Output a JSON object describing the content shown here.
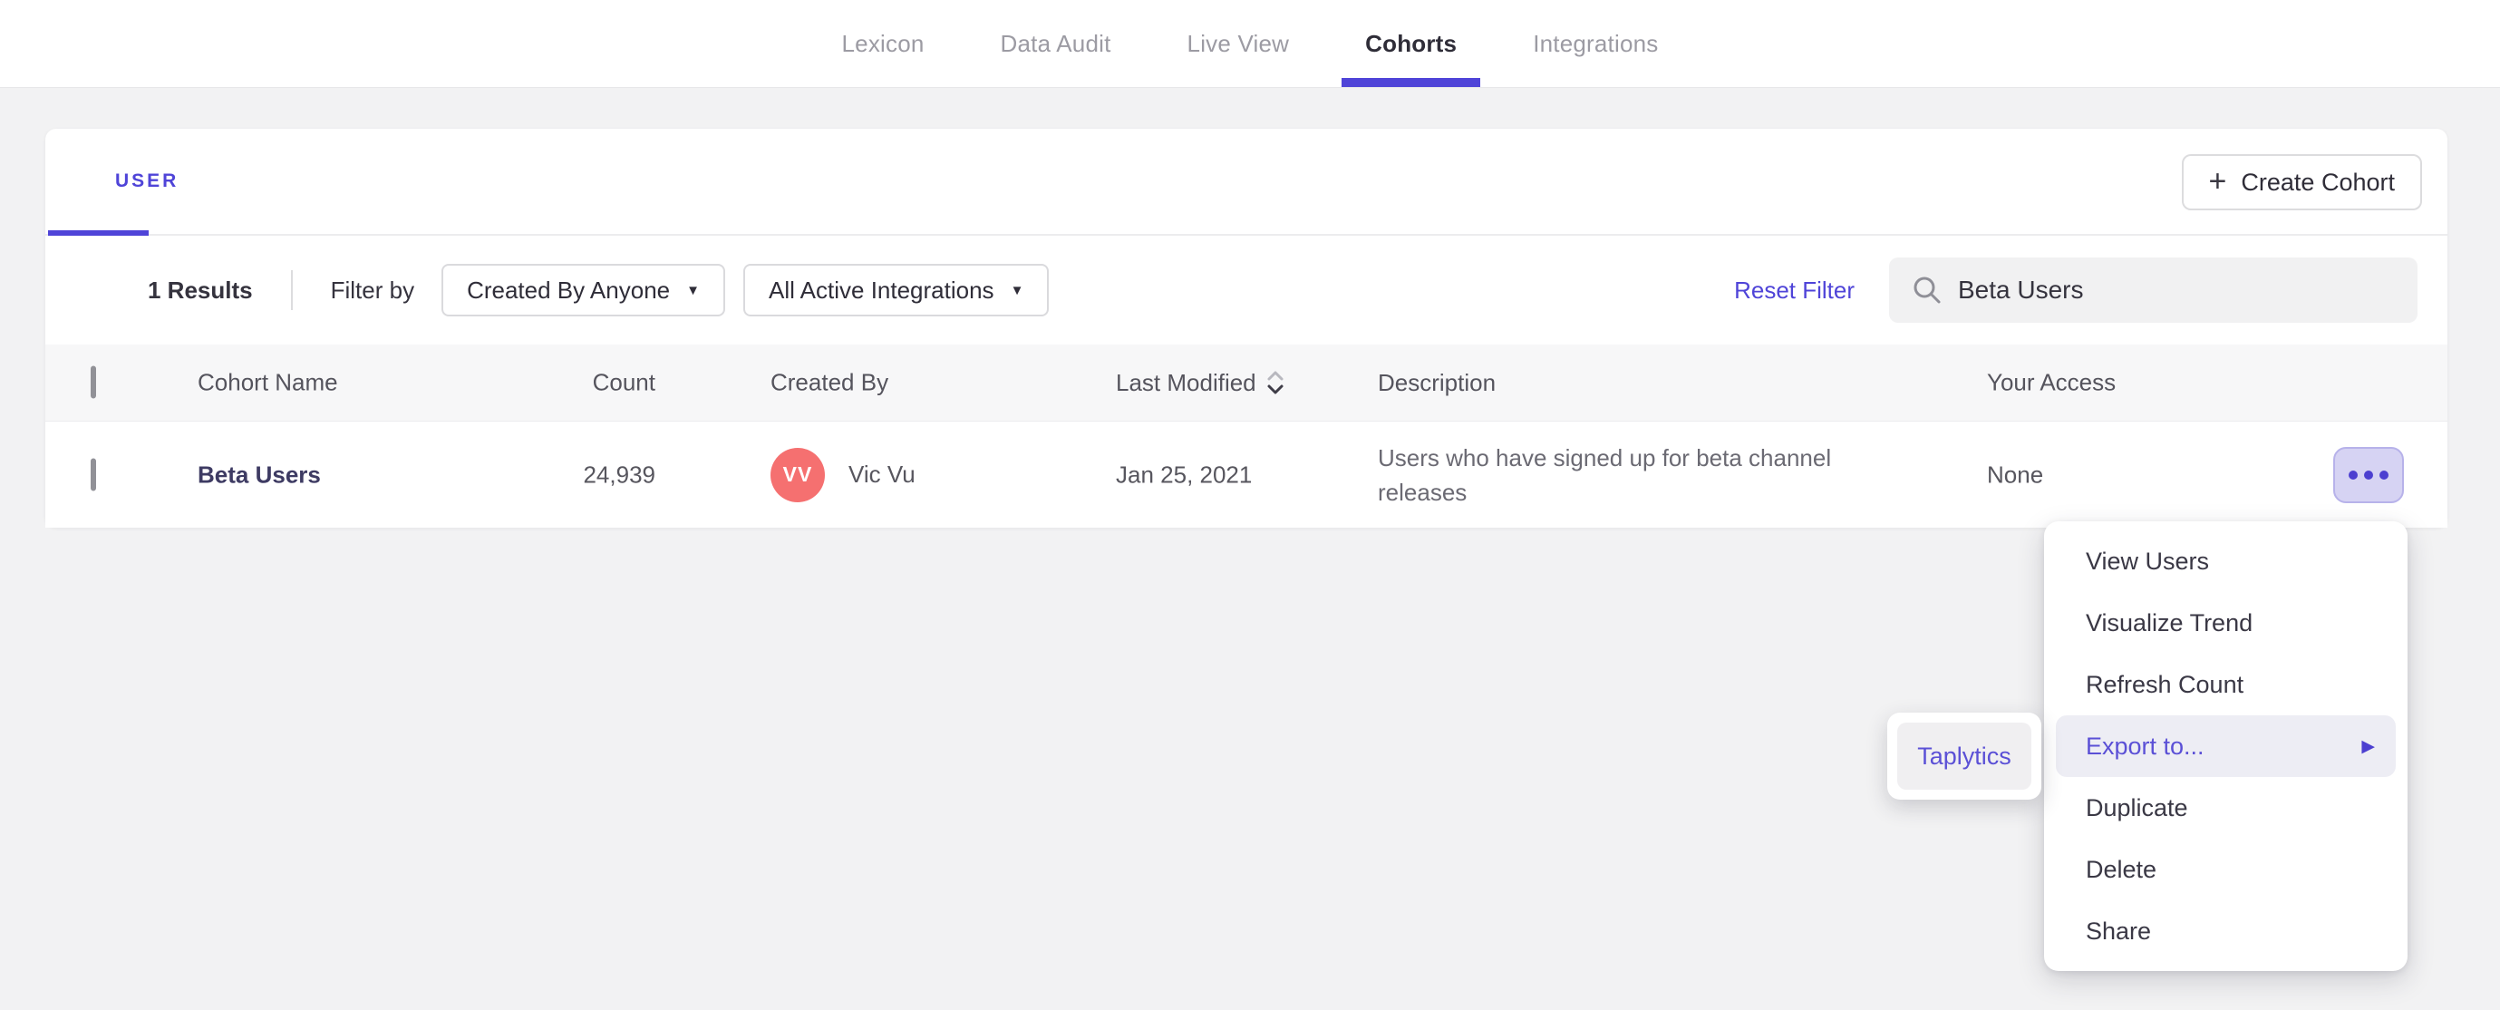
{
  "nav": {
    "items": [
      {
        "label": "Lexicon"
      },
      {
        "label": "Data Audit"
      },
      {
        "label": "Live View"
      },
      {
        "label": "Cohorts",
        "active": true
      },
      {
        "label": "Integrations"
      }
    ]
  },
  "cohort_panel": {
    "tab_user": "USER",
    "create_cohort_label": "Create Cohort",
    "filters": {
      "results_count": "1 Results",
      "filter_by": "Filter by",
      "created_by_filter": "Created By Anyone",
      "integrations_filter": "All Active Integrations",
      "reset_filter": "Reset Filter",
      "search_value": "Beta Users"
    },
    "table": {
      "headers": {
        "cohort_name": "Cohort Name",
        "count": "Count",
        "created_by": "Created By",
        "last_modified": "Last Modified",
        "description": "Description",
        "your_access": "Your Access"
      },
      "row": {
        "cohort_name": "Beta Users",
        "count": "24,939",
        "avatar_initials": "VV",
        "created_by": "Vic Vu",
        "last_modified": "Jan 25, 2021",
        "description": "Users who have signed up for beta channel releases",
        "your_access": "None"
      }
    }
  },
  "context_menu": {
    "items": [
      {
        "label": "View Users"
      },
      {
        "label": "Visualize Trend"
      },
      {
        "label": "Refresh Count"
      },
      {
        "label": "Export to...",
        "highlighted": true,
        "has_submenu": true
      },
      {
        "label": "Duplicate"
      },
      {
        "label": "Delete"
      },
      {
        "label": "Share"
      }
    ]
  },
  "submenu": {
    "items": [
      {
        "label": "Taplytics"
      }
    ]
  },
  "icons": {
    "plus": "+",
    "caret_down": "▼",
    "submenu_arrow": "▶"
  },
  "colors": {
    "accent": "#4f44d8",
    "avatar": "#f57070",
    "page_background": "#f2f2f3"
  }
}
